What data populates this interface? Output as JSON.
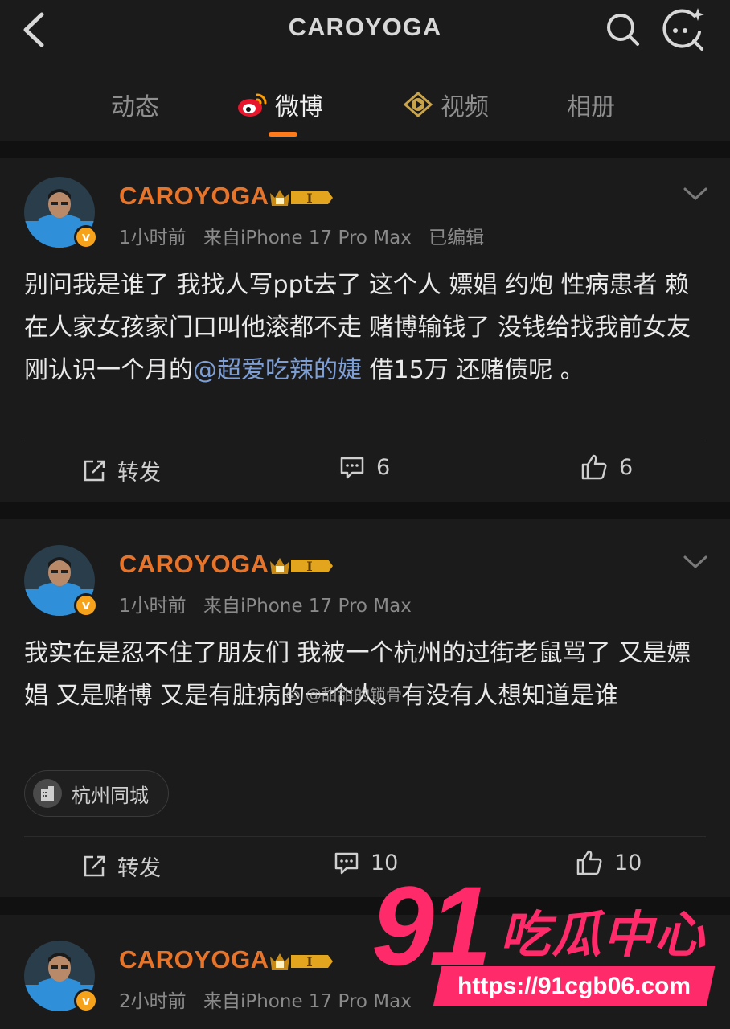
{
  "header": {
    "title": "CAROYOGA",
    "tabs": [
      {
        "label": "动态",
        "active": false
      },
      {
        "label": "微博",
        "active": true
      },
      {
        "label": "视频",
        "active": false
      },
      {
        "label": "相册",
        "active": false
      }
    ],
    "accent_color": "#ff7a1a"
  },
  "posts": [
    {
      "username": "CAROYOGA",
      "vip_level": "I",
      "verified_mark": "v",
      "time": "1小时前",
      "source": "来自iPhone 17 Pro Max",
      "edited": "已编辑",
      "content_before": "别问我是谁了 我找人写ppt去了 这个人 嫖娼 约炮 性病患者 赖在人家女孩家门口叫他滚都不走 赌博输钱了 没钱给找我前女友刚认识一个月的",
      "mention": "@超爱吃辣的婕",
      "content_after": " 借15万 还赌债呢 。",
      "repost_label": "转发",
      "comment_count": "6",
      "like_count": "6"
    },
    {
      "username": "CAROYOGA",
      "vip_level": "I",
      "verified_mark": "v",
      "time": "1小时前",
      "source": "来自iPhone 17 Pro Max",
      "content": "我实在是忍不住了朋友们 我被一个杭州的过街老鼠骂了 又是嫖娼 又是赌博 又是有脏病的一个人。有没有人想知道是谁",
      "location": "杭州同城",
      "repost_label": "转发",
      "comment_count": "10",
      "like_count": "10"
    },
    {
      "username": "CAROYOGA",
      "vip_level": "I",
      "verified_mark": "v",
      "time": "2小时前",
      "source": "来自iPhone 17 Pro Max"
    }
  ],
  "inline_watermark": "@甜甜的锁骨",
  "overlay_watermark": {
    "number": "91",
    "title": "吃瓜中心",
    "url": "https://91cgb06.com",
    "color": "#ff2a6a"
  }
}
